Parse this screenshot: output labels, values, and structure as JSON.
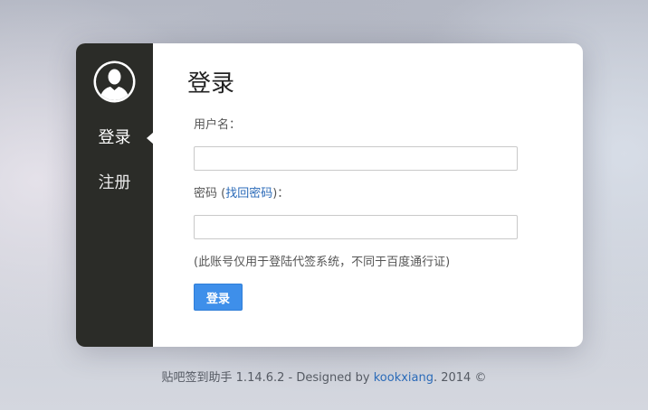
{
  "sidebar": {
    "items": [
      {
        "label": "登录",
        "active": true
      },
      {
        "label": "注册",
        "active": false
      }
    ],
    "avatar_icon": "user-silhouette-icon"
  },
  "form": {
    "title": "登录",
    "username_label": "用户名：",
    "password_label_prefix": "密码 (",
    "password_link": "找回密码",
    "password_label_suffix": ")：",
    "username_value": "",
    "password_value": "",
    "note": "(此账号仅用于登陆代签系统，不同于百度通行证)",
    "submit_label": "登录"
  },
  "footer": {
    "prefix": "贴吧签到助手 1.14.6.2 - Designed by ",
    "author": "kookxiang",
    "suffix": ". 2014 ©"
  },
  "colors": {
    "sidebar_bg": "#2b2c28",
    "accent": "#3e8fea",
    "link": "#2a6ab8"
  }
}
